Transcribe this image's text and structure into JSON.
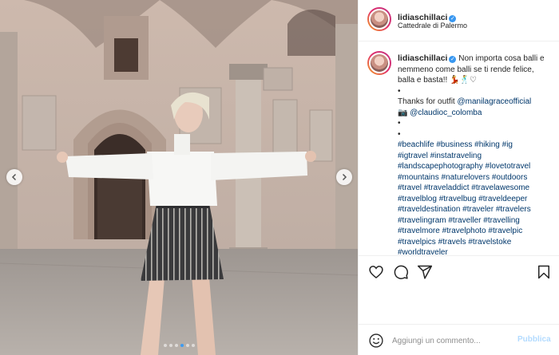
{
  "photo": {
    "alt_scene": "woman in white blouse and striped shorts with arms outstretched in a cathedral courtyard",
    "carousel_count": 6,
    "carousel_active_index": 3
  },
  "header": {
    "username": "lidiaschillaci",
    "location": "Cattedrale di Palermo"
  },
  "caption": {
    "username": "lidiaschillaci",
    "lines": [
      " Non importa cosa balli e",
      "nemmeno come balli se ti rende felice,",
      "balla e basta!! 💃🕺♡",
      "•",
      "Thanks for outfit ",
      "📷 ",
      "•",
      "•"
    ],
    "mentions": [
      "@manilagraceofficial",
      "@claudioc_colomba"
    ],
    "hashtag_lines": [
      "#beachlife #business #hiking #ig",
      "#igtravel #instatraveling",
      "#landscapephotography #lovetotravel",
      "#mountains #naturelovers #outdoors",
      "#travel #traveladdict #travelawesome",
      "#travelblog #travelbug #traveldeeper",
      "#traveldestination #traveler #travelers",
      "#travelingram #traveller #travelling",
      "#travelmore #travelphoto #travelpic",
      "#travelpics #travels #travelstoke",
      "#worldtraveler"
    ]
  },
  "comment": {
    "placeholder": "Aggiungi un commento...",
    "publish_label": "Pubblica"
  },
  "colors": {
    "link": "#00376b",
    "verified": "#3897f0",
    "publish_disabled": "#b3dbff",
    "carousel_active": "#3e9bf0"
  }
}
